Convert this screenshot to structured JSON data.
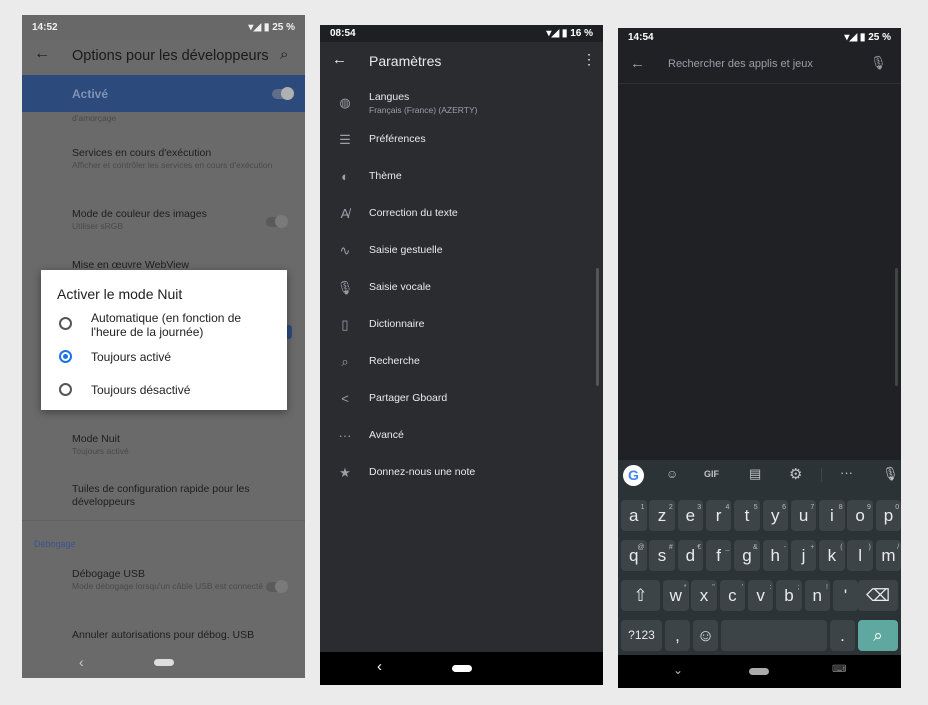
{
  "panel1": {
    "time": "14:52",
    "battery": "25 %",
    "title": "Options pour les développeurs",
    "master_label": "Activé",
    "items": [
      {
        "title": "",
        "subtitle": "d'amorçage"
      },
      {
        "title": "Services en cours d'exécution",
        "subtitle": "Afficher et contrôler les services en cours d'exécution"
      },
      {
        "title": "Mode de couleur des images",
        "subtitle": "Utiliser sRGB"
      },
      {
        "title": "Mise en œuvre WebView",
        "subtitle": ""
      },
      {
        "title": "Mode Nuit",
        "subtitle": "Toujours activé"
      },
      {
        "title": "Tuiles de configuration rapide pour les développeurs",
        "subtitle": ""
      }
    ],
    "section": "Débogage",
    "items2": [
      {
        "title": "Débogage USB",
        "subtitle": "Mode débogage lorsqu'un câble USB est connecté"
      },
      {
        "title": "Annuler autorisations pour débog. USB",
        "subtitle": ""
      }
    ],
    "dialog": {
      "title": "Activer le mode Nuit",
      "options": [
        {
          "label": "Automatique (en fonction de l'heure de la journée)",
          "selected": false
        },
        {
          "label": "Toujours activé",
          "selected": true
        },
        {
          "label": "Toujours désactivé",
          "selected": false
        }
      ]
    },
    "accent": "#1a73e8"
  },
  "panel2": {
    "time": "08:54",
    "battery": "16 %",
    "title": "Paramètres",
    "items": [
      {
        "icon": "globe-icon",
        "glyph": "◍",
        "label": "Langues",
        "sub": "Français (France) (AZERTY)"
      },
      {
        "icon": "sliders-icon",
        "glyph": "☰",
        "label": "Préférences"
      },
      {
        "icon": "palette-icon",
        "glyph": "◐",
        "label": "Thème"
      },
      {
        "icon": "spellcheck-icon",
        "glyph": "A̸",
        "label": "Correction du texte"
      },
      {
        "icon": "gesture-icon",
        "glyph": "∿",
        "label": "Saisie gestuelle"
      },
      {
        "icon": "mic-icon",
        "glyph": "🎙",
        "label": "Saisie vocale"
      },
      {
        "icon": "book-icon",
        "glyph": "▯",
        "label": "Dictionnaire"
      },
      {
        "icon": "search-icon",
        "glyph": "⌕",
        "label": "Recherche"
      },
      {
        "icon": "share-icon",
        "glyph": "<",
        "label": "Partager Gboard"
      },
      {
        "icon": "more-icon",
        "glyph": "···",
        "label": "Avancé"
      },
      {
        "icon": "star-icon",
        "glyph": "★",
        "label": "Donnez-nous une note"
      }
    ]
  },
  "panel3": {
    "time": "14:54",
    "battery": "25 %",
    "search_placeholder": "Rechercher des applis et jeux",
    "toolbar": {
      "gif": "GIF"
    },
    "rows": [
      [
        [
          "a",
          "1"
        ],
        [
          "z",
          "2"
        ],
        [
          "e",
          "3"
        ],
        [
          "r",
          "4"
        ],
        [
          "t",
          "5"
        ],
        [
          "y",
          "6"
        ],
        [
          "u",
          "7"
        ],
        [
          "i",
          "8"
        ],
        [
          "o",
          "9"
        ],
        [
          "p",
          "0"
        ]
      ],
      [
        [
          "q",
          "@"
        ],
        [
          "s",
          "#"
        ],
        [
          "d",
          "€"
        ],
        [
          "f",
          "_"
        ],
        [
          "g",
          "&"
        ],
        [
          "h",
          "-"
        ],
        [
          "j",
          "+"
        ],
        [
          "k",
          "("
        ],
        [
          "l",
          ")"
        ],
        [
          "m",
          "/"
        ]
      ],
      [
        [
          "w",
          "*"
        ],
        [
          "x",
          "\""
        ],
        [
          "c",
          "'"
        ],
        [
          "v",
          ":"
        ],
        [
          "b",
          ";"
        ],
        [
          "n",
          "!"
        ],
        [
          "'",
          ""
        ]
      ]
    ],
    "sym_key": "?123",
    "comma": ",",
    "period": ".",
    "accent": "#5fa8a0"
  }
}
